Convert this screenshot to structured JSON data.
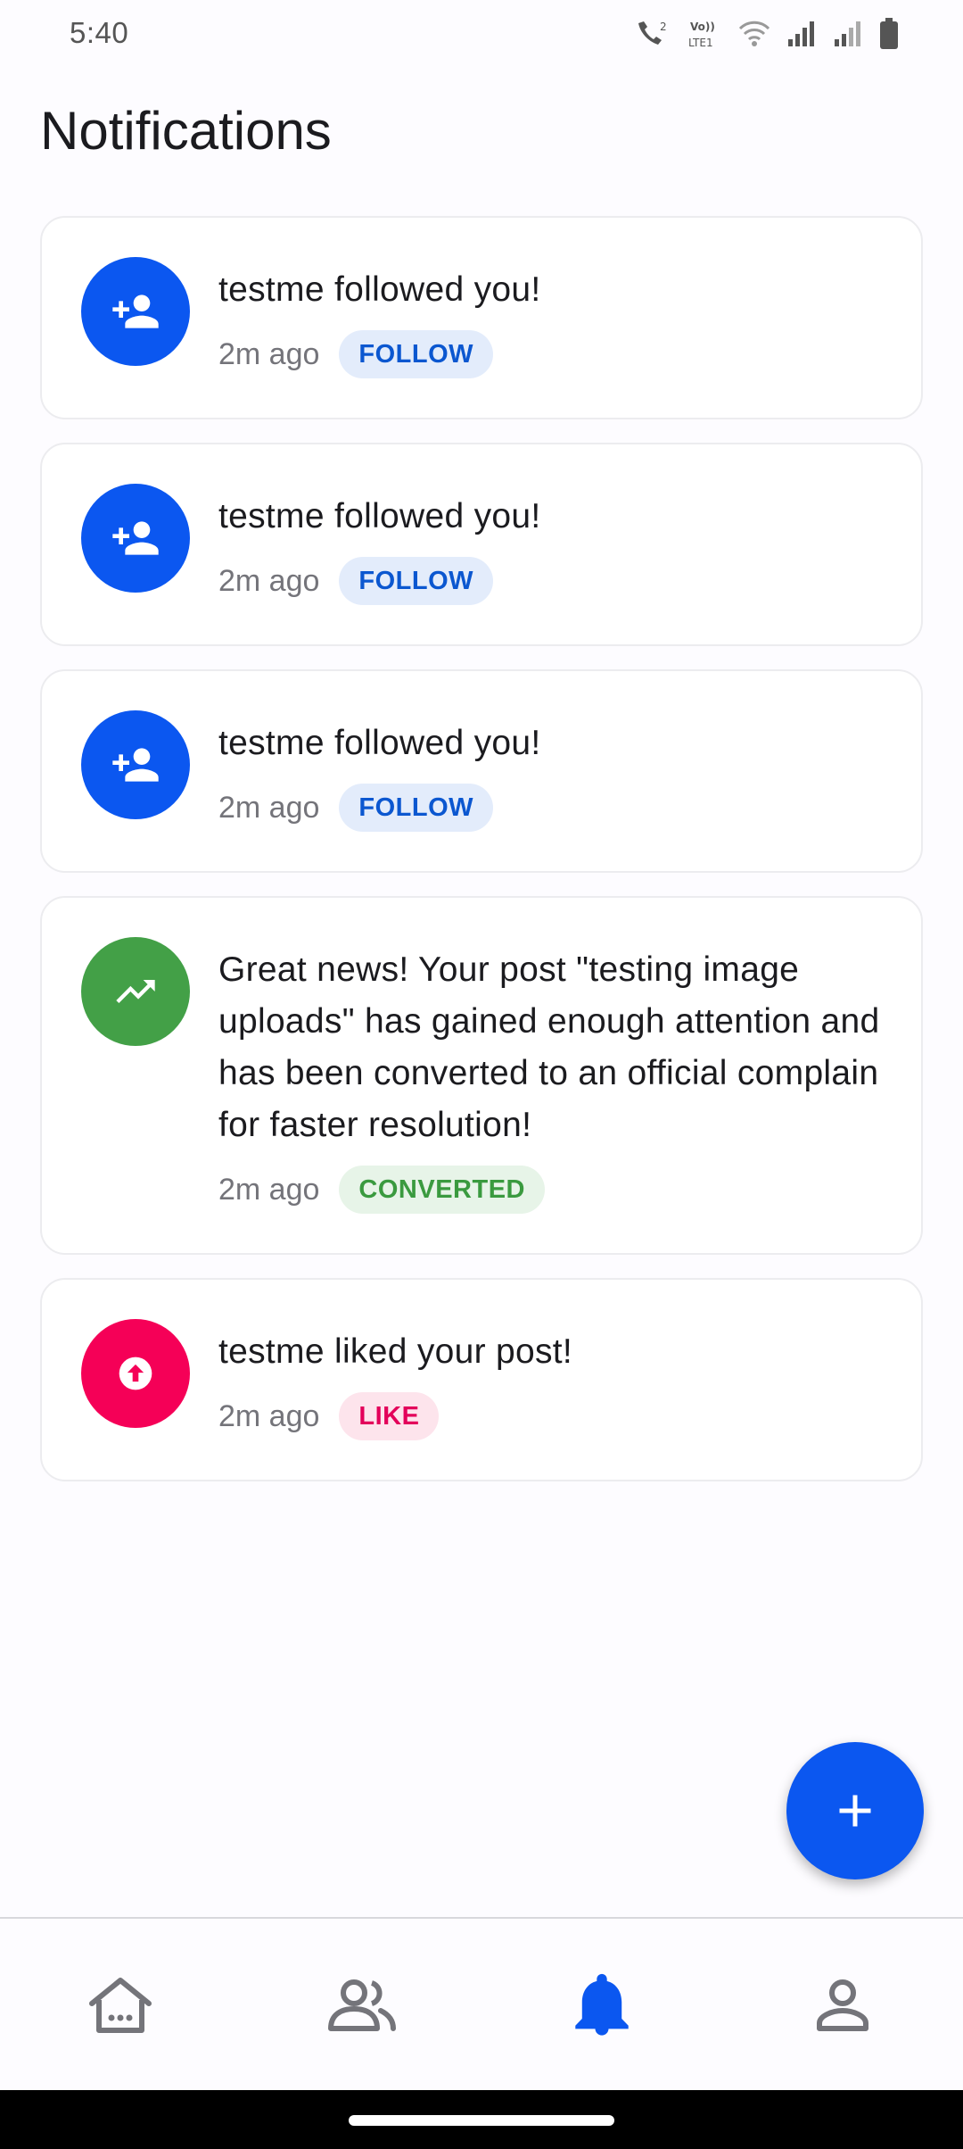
{
  "status_bar": {
    "time": "5:40",
    "icons": [
      "call-icon",
      "volte-icon",
      "wifi-icon",
      "signal-icon",
      "signal-weak-icon",
      "battery-icon"
    ]
  },
  "page": {
    "title": "Notifications"
  },
  "notifications": [
    {
      "icon": "person-add-icon",
      "icon_bg": "#0b57f0",
      "text": "testme followed you!",
      "time": "2m ago",
      "badge": "FOLLOW",
      "badge_color": "#0b57d0",
      "badge_bg": "#e3ecfb"
    },
    {
      "icon": "person-add-icon",
      "icon_bg": "#0b57f0",
      "text": "testme followed you!",
      "time": "2m ago",
      "badge": "FOLLOW",
      "badge_color": "#0b57d0",
      "badge_bg": "#e3ecfb"
    },
    {
      "icon": "person-add-icon",
      "icon_bg": "#0b57f0",
      "text": "testme followed you!",
      "time": "2m ago",
      "badge": "FOLLOW",
      "badge_color": "#0b57d0",
      "badge_bg": "#e3ecfb"
    },
    {
      "icon": "trending-up-icon",
      "icon_bg": "#43a047",
      "text": "Great news! Your post \"testing image uploads\" has gained enough attention and has been converted to an official complain for faster resolution!",
      "time": "2m ago",
      "badge": "CONVERTED",
      "badge_color": "#3a9a3f",
      "badge_bg": "#e7f4e8"
    },
    {
      "icon": "upvote-icon",
      "icon_bg": "#f50057",
      "text": "testme liked your post!",
      "time": "2m ago",
      "badge": "LIKE",
      "badge_color": "#e3005a",
      "badge_bg": "#fde4ec"
    }
  ],
  "fab": {
    "icon": "plus-icon",
    "color": "#0b57f0"
  },
  "bottom_nav": {
    "items": [
      {
        "icon": "home-icon",
        "active": false
      },
      {
        "icon": "group-icon",
        "active": false
      },
      {
        "icon": "bell-icon",
        "active": true
      },
      {
        "icon": "profile-icon",
        "active": false
      }
    ],
    "active_color": "#0b57f0",
    "inactive_color": "#74747a"
  }
}
